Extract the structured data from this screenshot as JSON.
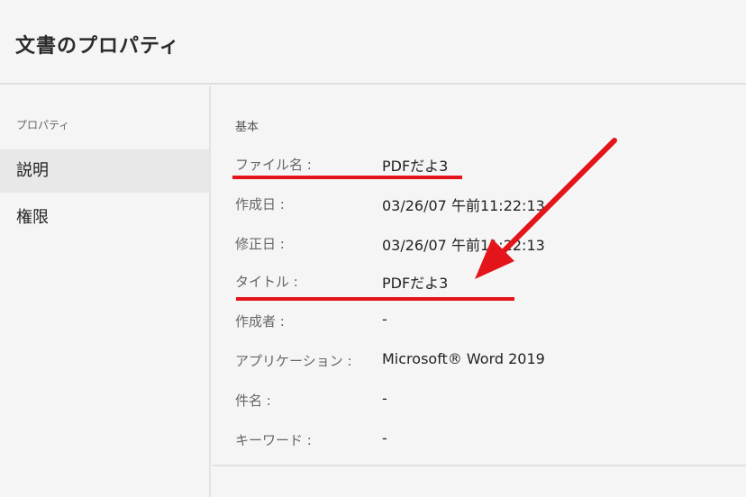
{
  "header": {
    "title": "文書のプロパティ"
  },
  "sidebar": {
    "heading": "プロパティ",
    "items": [
      {
        "label": "説明",
        "active": true
      },
      {
        "label": "権限",
        "active": false
      }
    ]
  },
  "main": {
    "section_label": "基本",
    "fields": [
      {
        "key": "ファイル名 :",
        "value": "PDFだよ3"
      },
      {
        "key": "作成日 :",
        "value": "03/26/07 午前11:22:13"
      },
      {
        "key": "修正日 :",
        "value": "03/26/07 午前11:22:13"
      },
      {
        "key": "タイトル :",
        "value": "PDFだよ3"
      },
      {
        "key": "作成者 :",
        "value": "-"
      },
      {
        "key": "アプリケーション :",
        "value": "Microsoft® Word 2019"
      },
      {
        "key": "件名 :",
        "value": "-"
      },
      {
        "key": "キーワード :",
        "value": "-"
      }
    ]
  },
  "annotations": {
    "color": "#e4141b"
  }
}
